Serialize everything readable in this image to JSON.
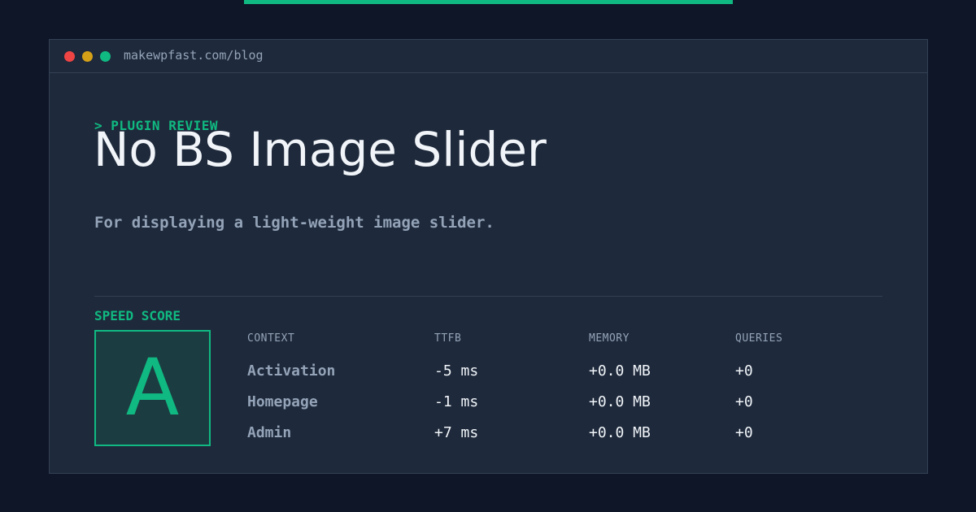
{
  "url": "makewpfast.com/blog",
  "colors": {
    "accent": "#10b981",
    "dot_red": "#ef4444",
    "dot_yellow": "#d4a017",
    "dot_green": "#10b981"
  },
  "eyebrow": "> PLUGIN REVIEW",
  "title": "No BS Image Slider",
  "subtitle": "For displaying a light-weight image slider.",
  "score": {
    "label": "SPEED SCORE",
    "grade": "A"
  },
  "table": {
    "headers": {
      "context": "CONTEXT",
      "ttfb": "TTFB",
      "memory": "MEMORY",
      "queries": "QUERIES"
    },
    "rows": [
      {
        "context": "Activation",
        "ttfb": "-5 ms",
        "memory": "+0.0 MB",
        "queries": "+0"
      },
      {
        "context": "Homepage",
        "ttfb": "-1 ms",
        "memory": "+0.0 MB",
        "queries": "+0"
      },
      {
        "context": "Admin",
        "ttfb": "+7 ms",
        "memory": "+0.0 MB",
        "queries": "+0"
      }
    ]
  }
}
